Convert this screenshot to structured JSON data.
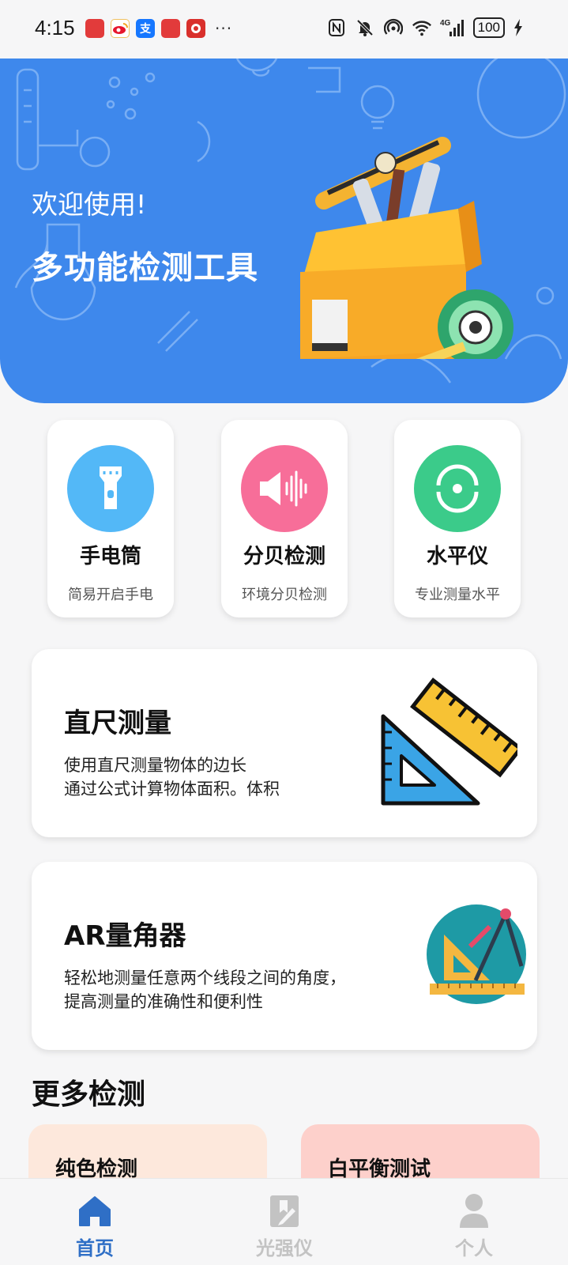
{
  "status_bar": {
    "time": "4:15",
    "battery": "100",
    "app_icons": [
      {
        "name": "app-notification-1",
        "glyph": "",
        "color": "#e23b3b"
      },
      {
        "name": "weibo-icon",
        "glyph": "",
        "color": "#f5a623"
      },
      {
        "name": "alipay-icon",
        "glyph": "支",
        "color": "#1677ff"
      },
      {
        "name": "app-notification-2",
        "glyph": "",
        "color": "#e23b3b"
      },
      {
        "name": "app-notification-3",
        "glyph": "",
        "color": "#d9302c"
      }
    ],
    "more": "···"
  },
  "banner": {
    "welcome": "欢迎使用!",
    "title": "多功能检测工具"
  },
  "tools": [
    {
      "title": "手电筒",
      "subtitle": "简易开启手电",
      "color": "#53b8f7",
      "icon": "flashlight-icon"
    },
    {
      "title": "分贝检测",
      "subtitle": "环境分贝检测",
      "color": "#f76e99",
      "icon": "sound-wave-icon"
    },
    {
      "title": "水平仪",
      "subtitle": "专业测量水平",
      "color": "#3bcb8a",
      "icon": "level-icon"
    }
  ],
  "features": [
    {
      "title": "直尺测量",
      "desc_line1": "使用直尺测量物体的边长",
      "desc_line2": "通过公式计算物体面积。体积",
      "icon": "ruler-icon"
    },
    {
      "title": "AR量角器",
      "desc": "轻松地测量任意两个线段之间的角度，提高测量的准确性和便利性",
      "icon": "protractor-icon"
    }
  ],
  "more_section": {
    "title": "更多检测",
    "items": [
      {
        "label": "纯色检测",
        "color": "#fde8dc"
      },
      {
        "label": "白平衡测试",
        "color": "#fdd0cb"
      }
    ]
  },
  "bottom_nav": [
    {
      "label": "首页",
      "icon": "home-icon",
      "active": true
    },
    {
      "label": "光强仪",
      "icon": "light-meter-icon",
      "active": false
    },
    {
      "label": "个人",
      "icon": "person-icon",
      "active": false
    }
  ],
  "colors": {
    "active_nav": "#2f6fc6",
    "inactive_nav": "#c3c3c3",
    "banner": "#3e88ec"
  }
}
